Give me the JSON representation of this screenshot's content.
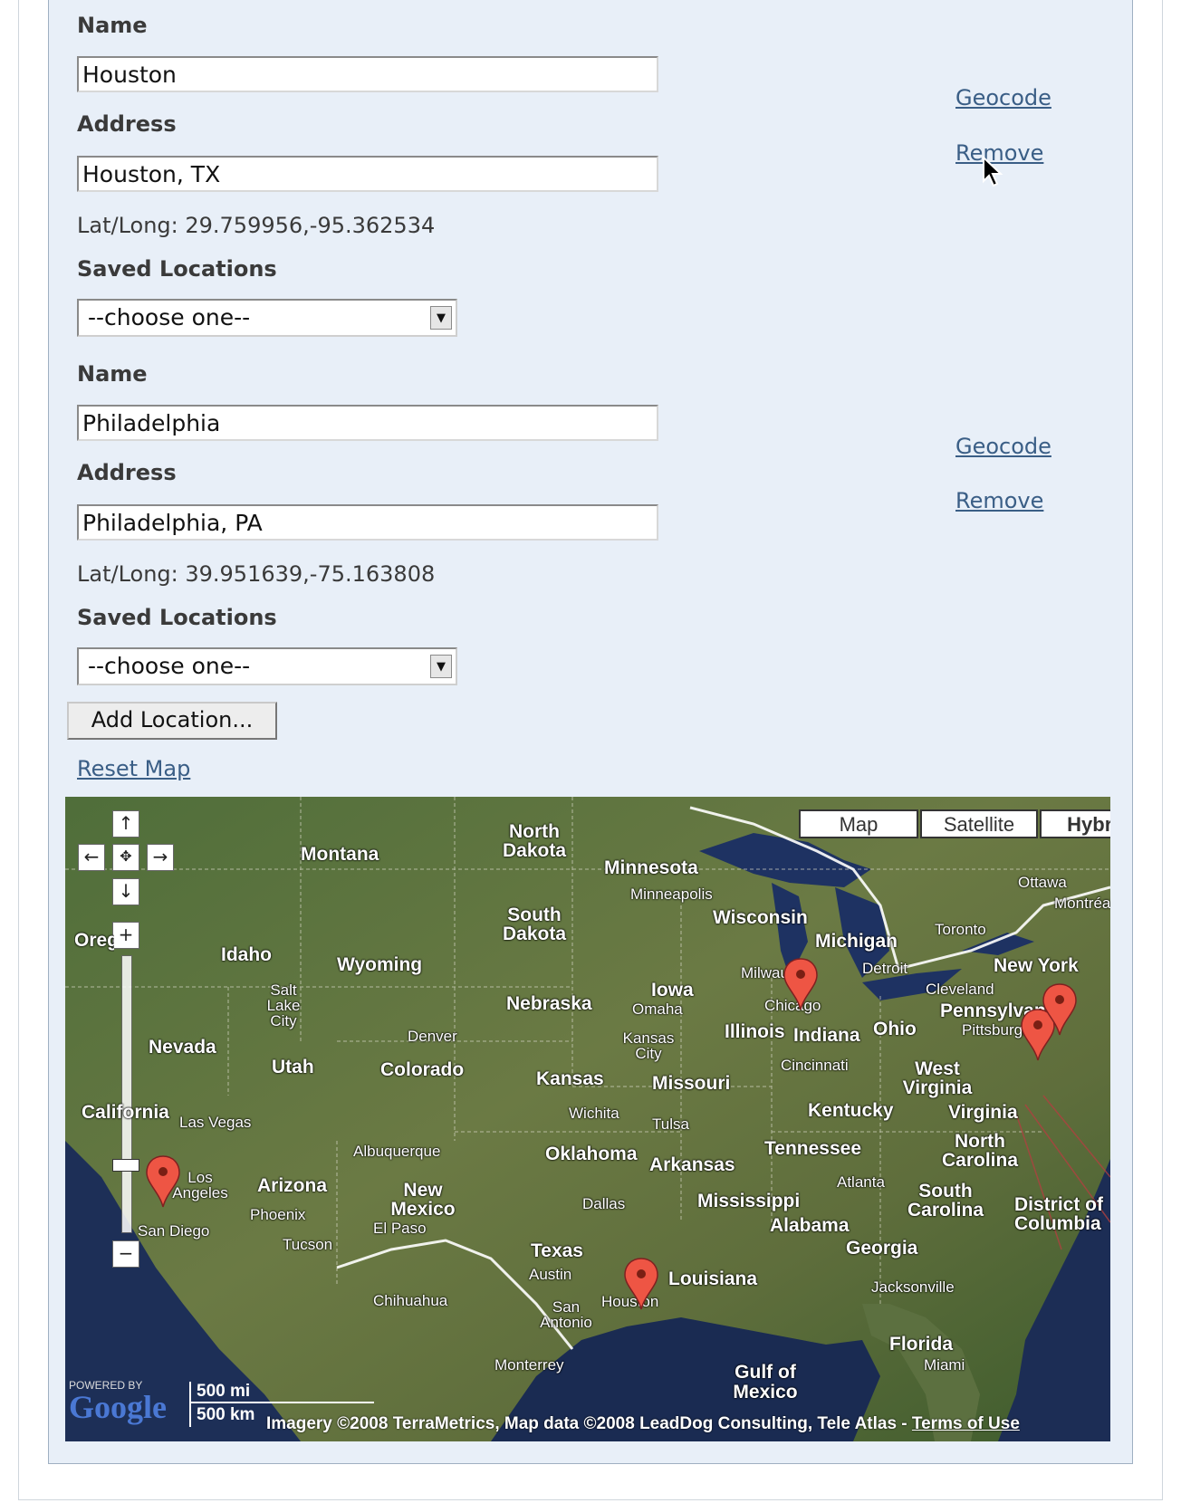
{
  "locations": [
    {
      "name_label": "Name",
      "name_value": "Houston",
      "address_label": "Address",
      "address_value": "Houston, TX",
      "latlong": "Lat/Long: 29.759956,-95.362534",
      "saved_label": "Saved Locations",
      "saved_value": "--choose one--",
      "geocode": "Geocode",
      "remove": "Remove"
    },
    {
      "name_label": "Name",
      "name_value": "Philadelphia",
      "address_label": "Address",
      "address_value": "Philadelphia, PA",
      "latlong": "Lat/Long: 39.951639,-75.163808",
      "saved_label": "Saved Locations",
      "saved_value": "--choose one--",
      "geocode": "Geocode",
      "remove": "Remove"
    }
  ],
  "add_button": "Add Location...",
  "reset_map": "Reset Map",
  "map": {
    "types": [
      "Map",
      "Satellite",
      "Hybrid"
    ],
    "selected_type": "Hybrid",
    "states": [
      "Montana",
      "North Dakota",
      "Minnesota",
      "South Dakota",
      "Wisconsin",
      "Michigan",
      "Idaho",
      "Wyoming",
      "Nebraska",
      "Iowa",
      "Illinois",
      "Indiana",
      "Ohio",
      "Pennsylvania",
      "New York",
      "Nevada",
      "Utah",
      "Colorado",
      "Kansas",
      "Missouri",
      "Kentucky",
      "West Virginia",
      "Virginia",
      "California",
      "Oklahoma",
      "Arkansas",
      "Tennessee",
      "North Carolina",
      "Arizona",
      "New Mexico",
      "Mississippi",
      "Alabama",
      "Georgia",
      "South Carolina",
      "Texas",
      "Louisiana",
      "Florida",
      "District of Columbia",
      "Oregon"
    ],
    "cities": [
      "Minneapolis",
      "Milwaukee",
      "Chicago",
      "Detroit",
      "Toronto",
      "Ottawa",
      "Montréal",
      "Cleveland",
      "Pittsburgh",
      "Omaha",
      "Denver",
      "Salt Lake City",
      "Kansas City",
      "Cincinnati",
      "Wichita",
      "Tulsa",
      "Las Vegas",
      "Los Angeles",
      "San Diego",
      "Phoenix",
      "Tucson",
      "Albuquerque",
      "El Paso",
      "Dallas",
      "Austin",
      "San Antonio",
      "Houston",
      "Atlanta",
      "Jacksonville",
      "Miami",
      "Monterrey",
      "Chihuahua"
    ],
    "scale_mi": "500 mi",
    "scale_km": "500 km",
    "powered_by": "POWERED BY",
    "logo": "Google",
    "copyright": "Imagery ©2008 TerraMetrics, Map data ©2008 LeadDog Consulting, Tele Atlas - ",
    "terms": "Terms of Use",
    "gulf": "Gulf of Mexico"
  }
}
